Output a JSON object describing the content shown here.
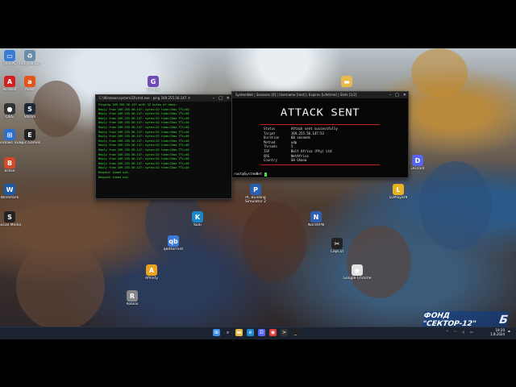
{
  "desktop": {
    "icons": [
      {
        "id": "this-pc",
        "label": "This PC",
        "color": "#3b7bd8",
        "glyph": "▭"
      },
      {
        "id": "recycle",
        "label": "Recycle Bin",
        "color": "#6c8da8",
        "glyph": "♻"
      },
      {
        "id": "acrobat",
        "label": "Acrobat",
        "color": "#d21f1f",
        "glyph": "A"
      },
      {
        "id": "avast",
        "label": "Avast",
        "color": "#e0561d",
        "glyph": "a"
      },
      {
        "id": "obs",
        "label": "OBS",
        "color": "#333",
        "glyph": "●"
      },
      {
        "id": "steam",
        "label": "Steam",
        "color": "#1b2838",
        "glyph": "S"
      },
      {
        "id": "windows-tools",
        "label": "Windows Tools",
        "color": "#2b6fd0",
        "glyph": "⊞"
      },
      {
        "id": "epic",
        "label": "Epic Games",
        "color": "#222",
        "glyph": "E"
      },
      {
        "id": "brave",
        "label": "Brave",
        "color": "#d4492a",
        "glyph": "B"
      },
      {
        "id": "wiresharkicn",
        "label": "Wireshark",
        "color": "#1d5aa6",
        "glyph": "W"
      },
      {
        "id": "folder",
        "label": "",
        "color": "#e8b84a",
        "glyph": "▬"
      },
      {
        "id": "github",
        "label": "GitHub",
        "color": "#6e4bb5",
        "glyph": "G"
      },
      {
        "id": "qbittorrent",
        "label": "qBittorrent",
        "color": "#3b7bd8",
        "glyph": "qb"
      },
      {
        "id": "affinity",
        "label": "Affinity",
        "color": "#e8a21c",
        "glyph": "A"
      },
      {
        "id": "kodi",
        "label": "Kodi",
        "color": "#1b87c9",
        "glyph": "K"
      },
      {
        "id": "pc-building",
        "label": "PC Building Simulator 2",
        "color": "#2a60b0",
        "glyph": "P"
      },
      {
        "id": "capcut",
        "label": "CapCut",
        "color": "#222",
        "glyph": "✂"
      },
      {
        "id": "google-chrome-2",
        "label": "Google Chrome",
        "color": "#e0e0e0",
        "glyph": "◉"
      },
      {
        "id": "discord",
        "label": "Discord",
        "color": "#5865f2",
        "glyph": "D"
      },
      {
        "id": "ldplayer",
        "label": "LDPlayer9",
        "color": "#e8b220",
        "glyph": "L"
      },
      {
        "id": "nordvpn",
        "label": "NordVPN",
        "color": "#2d5fb4",
        "glyph": "N"
      },
      {
        "id": "social-media",
        "label": "Social Media",
        "color": "#222",
        "glyph": "S"
      },
      {
        "id": "roblox",
        "label": "Roblox",
        "color": "#888",
        "glyph": "R"
      }
    ],
    "watermark_text": "ФОНД \"СЕКТОР-12\"",
    "watermark_mark": "Б"
  },
  "ping_window": {
    "title": "C:\\Windows\\system32\\cmd.exe - ping  169.255.56.147 -t",
    "lines": [
      "Pinging 169.255.56.147 with 32 bytes of data:",
      "Reply from 169.255.56.147: bytes=32 time=15ms TTL=46",
      "Reply from 169.255.56.147: bytes=32 time=15ms TTL=46",
      "Reply from 169.255.56.147: bytes=32 time=15ms TTL=46",
      "Reply from 169.255.56.147: bytes=32 time=15ms TTL=46",
      "Reply from 169.255.56.147: bytes=32 time=15ms TTL=46",
      "Reply from 169.255.56.147: bytes=32 time=15ms TTL=46",
      "Reply from 169.255.56.147: bytes=32 time=15ms TTL=46",
      "Reply from 169.255.56.147: bytes=32 time=15ms TTL=46",
      "Reply from 169.255.56.147: bytes=32 time=15ms TTL=46",
      "Reply from 169.255.56.147: bytes=32 time=15ms TTL=46",
      "Reply from 169.255.56.147: bytes=32 time=15ms TTL=46",
      "Reply from 169.255.56.147: bytes=32 time=15ms TTL=46",
      "Reply from 169.255.56.147: bytes=32 time=15ms TTL=46",
      "Reply from 169.255.56.147: bytes=32 time=15ms TTL=46",
      "Request timed out.",
      "Request timed out."
    ]
  },
  "attack_window": {
    "title": "SystemNet  |  Sessions [0]  |  Username [root]  |  Expires [Lifetime]  |  Slots [1/2]",
    "heading": "ATTACK SENT",
    "rows": [
      {
        "key": "Status",
        "value": "Attack sent successfully"
      },
      {
        "key": "Target",
        "value": "169.255.56.147:53"
      },
      {
        "key": "Duration",
        "value": "60 seconds"
      },
      {
        "key": "Method",
        "value": "udp"
      },
      {
        "key": "Threads",
        "value": "5"
      },
      {
        "key": "ISP",
        "value": "Bolt Africa (Pty) Ltd"
      },
      {
        "key": "ORG",
        "value": "NetAfrica"
      },
      {
        "key": "Country",
        "value": "GH  Ghana"
      }
    ],
    "prompt": "root@SystemNet"
  },
  "taskbar": {
    "apps": [
      {
        "id": "start",
        "glyph": "⊞",
        "color": "#3b8fe8"
      },
      {
        "id": "search",
        "glyph": "⌕",
        "color": "#1b2230"
      },
      {
        "id": "explorer",
        "glyph": "▬",
        "color": "#e8b84a"
      },
      {
        "id": "edge",
        "glyph": "e",
        "color": "#1f8ad0"
      },
      {
        "id": "discord-tb",
        "glyph": "D",
        "color": "#5865f2"
      },
      {
        "id": "chrome",
        "glyph": "◉",
        "color": "#d9433a"
      },
      {
        "id": "terminal",
        "glyph": ">",
        "color": "#333"
      },
      {
        "id": "cmd",
        "glyph": "_",
        "color": "#222"
      }
    ],
    "time": "19:20",
    "date": "1.8.2024"
  }
}
